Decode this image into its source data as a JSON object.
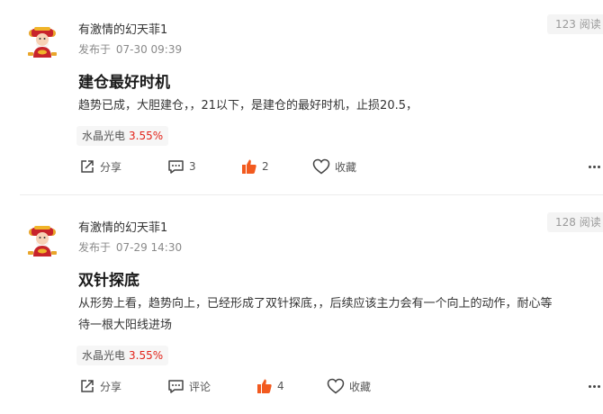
{
  "posts": [
    {
      "username": "有激情的幻天菲1",
      "published_prefix": "发布于",
      "published_time": "07-30 09:39",
      "views": "123 阅读",
      "title": "建仓最好时机",
      "body_lines": [
        "趋势已成，大胆建仓，，21以下，是建仓的最好时机，止损20.5，"
      ],
      "stock": {
        "name": "水晶光电",
        "change": "3.55%"
      },
      "actions": {
        "share": "分享",
        "comments": "3",
        "likes": "2",
        "favorite": "收藏"
      }
    },
    {
      "username": "有激情的幻天菲1",
      "published_prefix": "发布于",
      "published_time": "07-29 14:30",
      "views": "128 阅读",
      "title": "双针探底",
      "body_lines": [
        "从形势上看，趋势向上，已经形成了双针探底，，后续应该主力会有一个向上的动作，耐心等",
        "待一根大阳线进场"
      ],
      "stock": {
        "name": "水晶光电",
        "change": "3.55%"
      },
      "actions": {
        "share": "分享",
        "comments": "评论",
        "likes": "4",
        "favorite": "收藏"
      }
    }
  ],
  "colors": {
    "like": "#f25a1f",
    "stock_change": "#e2231a",
    "accent_tag_bg": "#f6f6f6"
  },
  "icons": [
    "avatar-caishen",
    "share-icon",
    "comment-icon",
    "thumbs-up-icon",
    "heart-icon",
    "more-icon"
  ]
}
